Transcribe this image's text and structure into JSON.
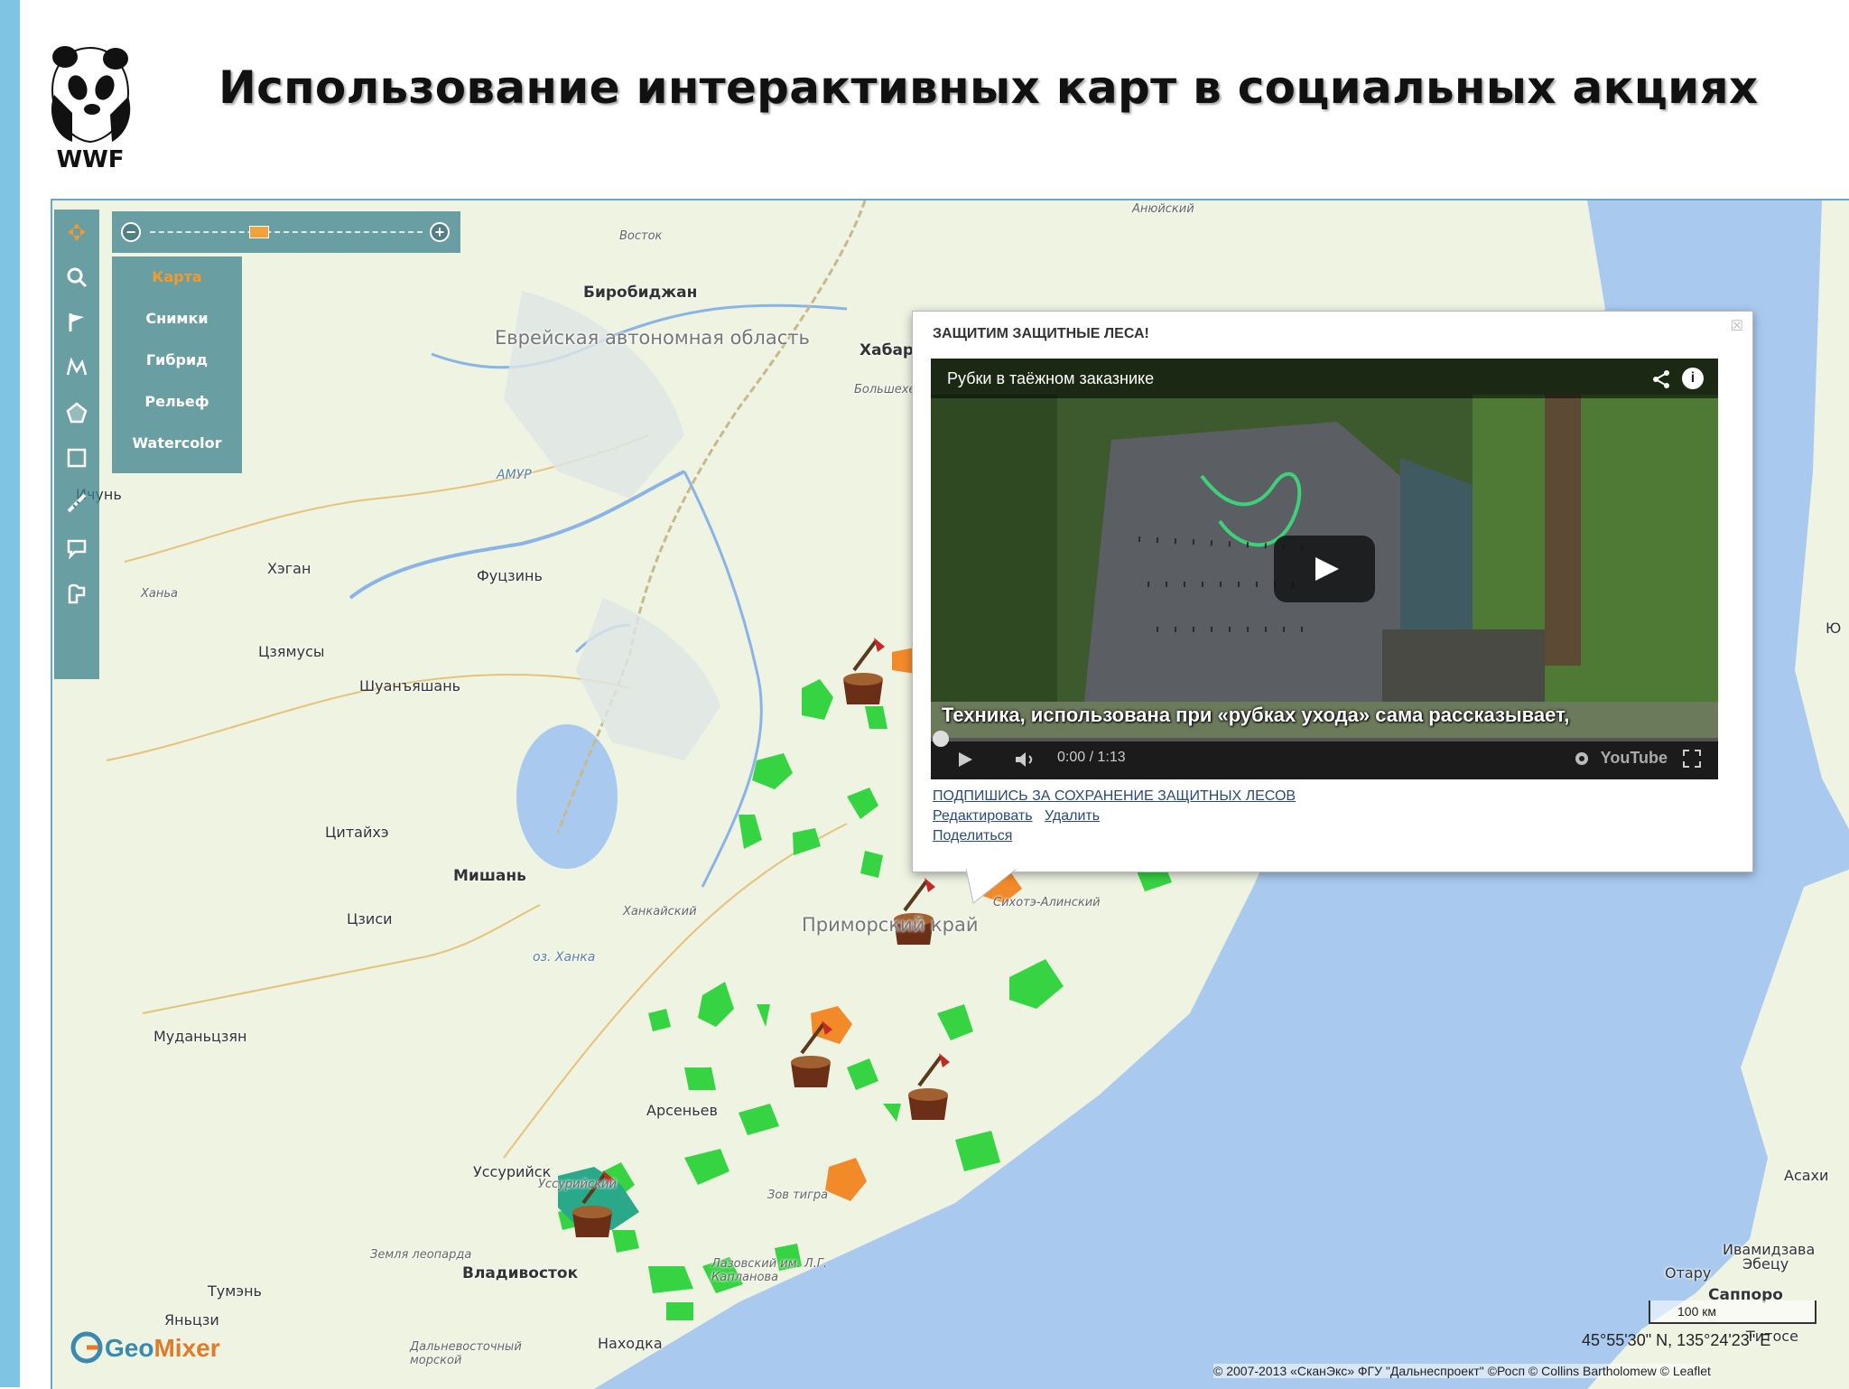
{
  "slide": {
    "title": "Использование интерактивных карт в социальных акциях",
    "logo_text": "WWF",
    "logo_icon": "panda-icon",
    "accent_color": "#7fc4e3"
  },
  "map": {
    "layers": [
      "Карта",
      "Снимки",
      "Гибрид",
      "Рельеф",
      "Watercolor"
    ],
    "active_layer": "Карта",
    "tools": [
      "pan-icon",
      "zoom-icon",
      "flag-icon",
      "polyline-icon",
      "polygon-icon",
      "rectangle-icon",
      "ruler-icon",
      "comment-icon",
      "area-icon"
    ],
    "places": {
      "birobidzhan": "Биробиджан",
      "evr_oblast": "Еврейская автономная область",
      "khabarovsk": "Хабар",
      "amur": "АМУР",
      "ichun": "Ичунь",
      "khegan": "Хэган",
      "fuczin": "Фуцзинь",
      "hanya": "Ханьа",
      "czyamusy": "Цзямусы",
      "shuanyashan": "Шуанъяшань",
      "citaykhe": "Цитайхэ",
      "mishan": "Мишань",
      "czisi": "Цзиси",
      "mudanczyan": "Муданьцзян",
      "khanka": "оз. Ханка",
      "primorsky": "Приморский край",
      "arsenyev": "Арсеньев",
      "ussuriysk": "Уссурийск",
      "vladivostok": "Владивосток",
      "nakhodka": "Находка",
      "sikhote": "Сихотэ-Алинский",
      "bolshekhekh": "Большехехцирский",
      "bostok": "Восток",
      "anyuysky": "Анюйский",
      "hankaysky": "Ханкайский",
      "zov_tigra": "Зов тигра",
      "lazovsky": "Лазовский им. Л.Г. Капланова",
      "yanchi": "Яньцзи",
      "tumen": "Тумэнь",
      "zemlya_leoparda": "Земля леопарда",
      "dalnevost": "Дальневосточный морской",
      "ussuriysky_zap": "Уссурийский",
      "sapporo": "Саппоро",
      "otaru": "Отару",
      "ivamidzava": "Ивамидзава",
      "ebecu": "Эбецу",
      "titose": "Титосе",
      "asakhi": "Асахи",
      "yu": "Ю"
    },
    "popup": {
      "title": "ЗАЩИТИМ ЗАЩИТНЫЕ ЛЕСА!",
      "video_title": "Рубки в таёжном заказнике",
      "subtitle": "Техника, использована при «рубках ухода» сама рассказывает,",
      "time": "0:00 / 1:13",
      "youtube": "YouTube",
      "link_petition": "ПОДПИШИСЬ ЗА СОХРАНЕНИЕ ЗАЩИТНЫХ ЛЕСОВ",
      "link_edit": "Редактировать",
      "link_delete": "Удалить",
      "link_share": "Поделиться",
      "close": "☒"
    },
    "scale": "100 км",
    "coords": "45°55'30\" N, 135°24'23\" E",
    "attribution": "© 2007-2013 «СканЭкс» ФГУ \"Дальнеспроект\" ©Росп © Collins Bartholomew © Leaflet",
    "brand": {
      "geo": "Geo",
      "mixer": "Mixer"
    },
    "colors": {
      "land": "#eef3e2",
      "sea": "#a9c9ef",
      "forest_marker": "#36d442",
      "orange_marker": "#f28a2a"
    }
  }
}
